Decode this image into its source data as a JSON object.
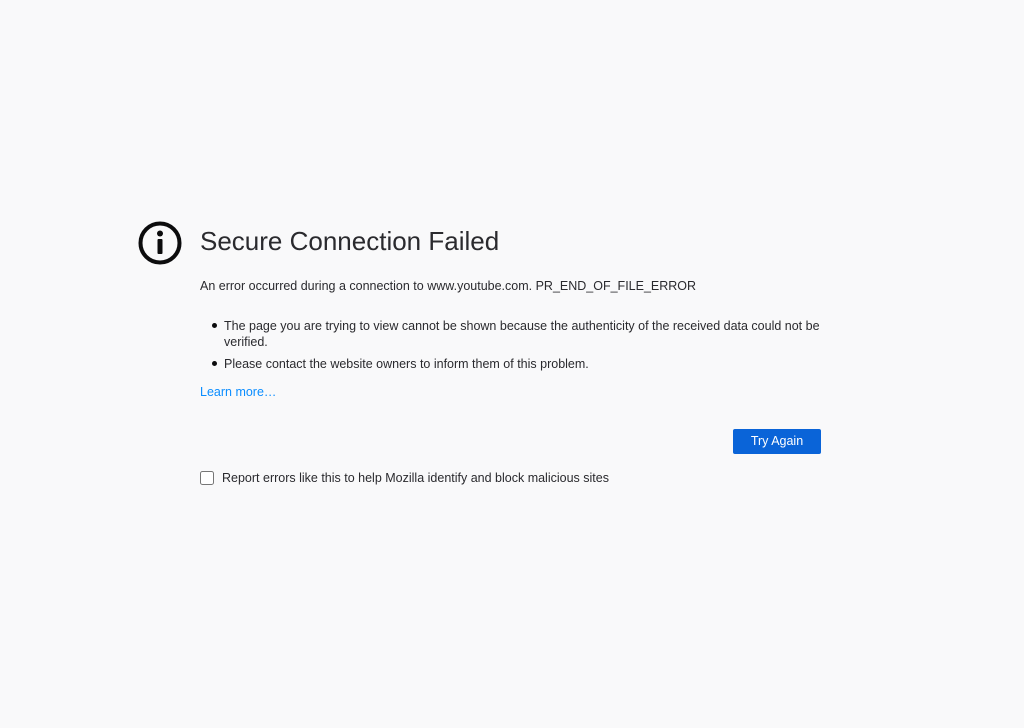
{
  "error": {
    "icon": "info-icon",
    "title": "Secure Connection Failed",
    "short_description": "An error occurred during a connection to www.youtube.com. PR_END_OF_FILE_ERROR",
    "details": [
      "The page you are trying to view cannot be shown because the authenticity of the received data could not be verified.",
      "Please contact the website owners to inform them of this problem."
    ],
    "learn_more": "Learn more…"
  },
  "actions": {
    "try_again_label": "Try Again",
    "report_checkbox_label": "Report errors like this to help Mozilla identify and block malicious sites",
    "report_checked": false
  },
  "colors": {
    "background": "#f9f9fa",
    "primary_button": "#0a64d8",
    "link": "#0a8dff"
  }
}
